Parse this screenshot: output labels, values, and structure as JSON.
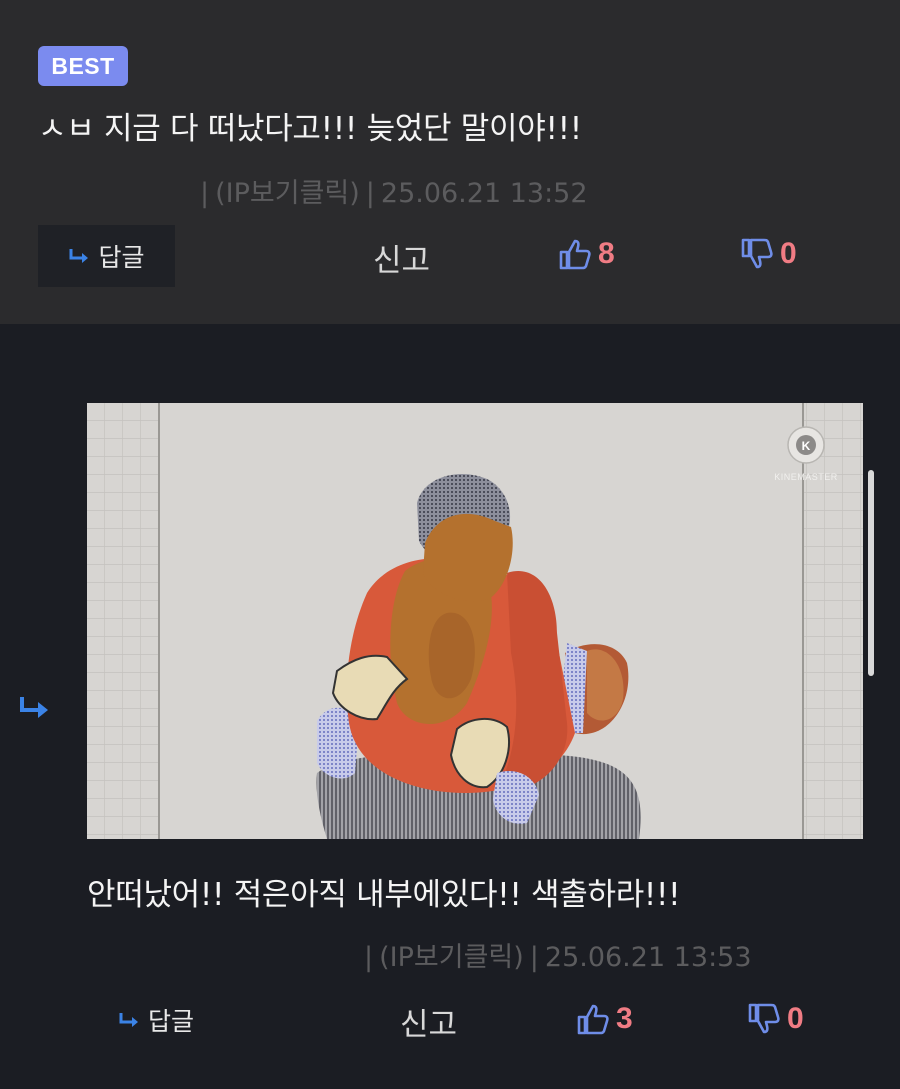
{
  "best_comment": {
    "badge": "BEST",
    "text": "ㅅㅂ 지금 다 떠났다고!!! 늦었단 말이야!!!",
    "meta": {
      "ip_label": "(IP보기클릭)",
      "timestamp": "25.06.21 13:52"
    },
    "reply_label": "답글",
    "report_label": "신고",
    "likes": "8",
    "dislikes": "0"
  },
  "reply_comment": {
    "image": {
      "watermark": "KINEMASTER",
      "watermark_icon": "kinemaster-logo"
    },
    "text": "안떠났어!! 적은아직 내부에있다!! 색출하라!!!",
    "meta": {
      "ip_label": "(IP보기클릭)",
      "timestamp": "25.06.21 13:53"
    },
    "reply_label": "답글",
    "report_label": "신고",
    "likes": "3",
    "dislikes": "0"
  },
  "colors": {
    "accent_badge": "#7b8bef",
    "like": "#6f8de8",
    "count": "#f07c84",
    "reply_arrow": "#3b83e6"
  }
}
